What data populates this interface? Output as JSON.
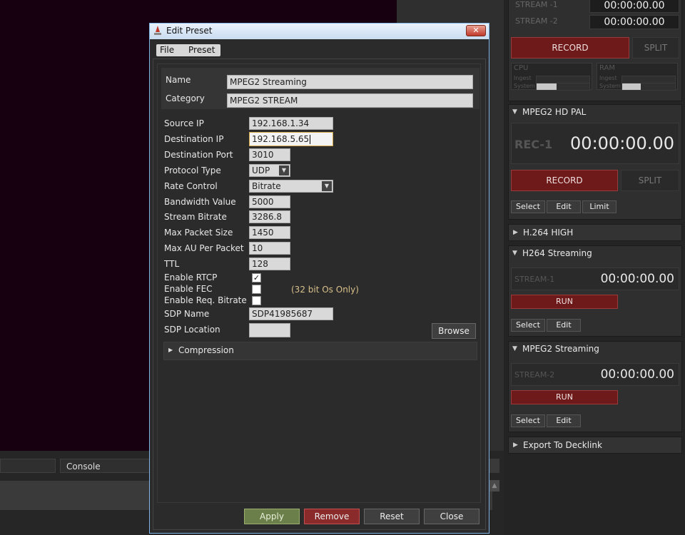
{
  "colors": {
    "preview_bg": "#17000f",
    "record_red": "#6e1a1a",
    "apply_green": "#6b7f4a",
    "remove_red": "#8a2a2a",
    "focus_border": "#d6a84a",
    "dialog_border": "#7eb3e6"
  },
  "background": {
    "console_tab": "Console"
  },
  "right_panel": {
    "top_streams": [
      {
        "label": "STREAM -1",
        "time": "00:00:00.00"
      },
      {
        "label": "STREAM -2",
        "time": "00:00:00.00"
      }
    ],
    "top_record": "RECORD",
    "top_split": "SPLIT",
    "cpu": {
      "label": "CPU",
      "ingest": "Ingest",
      "system": "System",
      "system_level": 0.38
    },
    "ram": {
      "label": "RAM",
      "ingest": "Ingest",
      "system": "System",
      "system_level": 0.35
    },
    "mpeg2_hd_pal": {
      "title": "MPEG2 HD PAL",
      "rec_label": "REC-1",
      "time": "00:00:00.00",
      "record": "RECORD",
      "split": "SPLIT",
      "select": "Select",
      "edit": "Edit",
      "limit": "Limit"
    },
    "h264_high": {
      "title": "H.264 HIGH"
    },
    "h264_streaming": {
      "title": "H264 Streaming",
      "stream_label": "STREAM-1",
      "time": "00:00:00.00",
      "run": "RUN",
      "select": "Select",
      "edit": "Edit"
    },
    "mpeg2_streaming": {
      "title": "MPEG2 Streaming",
      "stream_label": "STREAM-2",
      "time": "00:00:00.00",
      "run": "RUN",
      "select": "Select",
      "edit": "Edit"
    },
    "export": {
      "title": "Export To Decklink"
    }
  },
  "dialog": {
    "title": "Edit Preset",
    "close_glyph": "✕",
    "menu": [
      "File",
      "Preset"
    ],
    "name_label": "Name",
    "name_value": "MPEG2 Streaming",
    "category_label": "Category",
    "category_value": "MPEG2 STREAM",
    "fields": {
      "source_ip": {
        "label": "Source IP",
        "value": "192.168.1.34"
      },
      "destination_ip": {
        "label": "Destination IP",
        "value": "192.168.5.65"
      },
      "destination_port": {
        "label": "Destination Port",
        "value": "3010"
      },
      "protocol_type": {
        "label": "Protocol Type",
        "value": "UDP"
      },
      "rate_control": {
        "label": "Rate Control",
        "value": "Bitrate"
      },
      "bandwidth_value": {
        "label": "Bandwidth Value",
        "value": "5000"
      },
      "stream_bitrate": {
        "label": "Stream Bitrate",
        "value": "3286.8"
      },
      "max_packet_size": {
        "label": "Max Packet Size",
        "value": "1450"
      },
      "max_au_per_packet": {
        "label": "Max AU Per Packet",
        "value": "10"
      },
      "ttl": {
        "label": "TTL",
        "value": "128"
      },
      "sdp_name": {
        "label": "SDP Name",
        "value": "SDP41985687"
      },
      "sdp_location": {
        "label": "SDP Location",
        "value": ""
      }
    },
    "checks": {
      "enable_rtcp": {
        "label": "Enable RTCP",
        "checked": true
      },
      "enable_fec": {
        "label": "Enable FEC",
        "checked": false
      },
      "enable_req_bitrate": {
        "label": "Enable Req. Bitrate",
        "checked": false
      }
    },
    "fec_note": "(32 bit Os Only)",
    "browse": "Browse",
    "compression": "Compression",
    "buttons": {
      "apply": "Apply",
      "remove": "Remove",
      "reset": "Reset",
      "close": "Close"
    }
  }
}
